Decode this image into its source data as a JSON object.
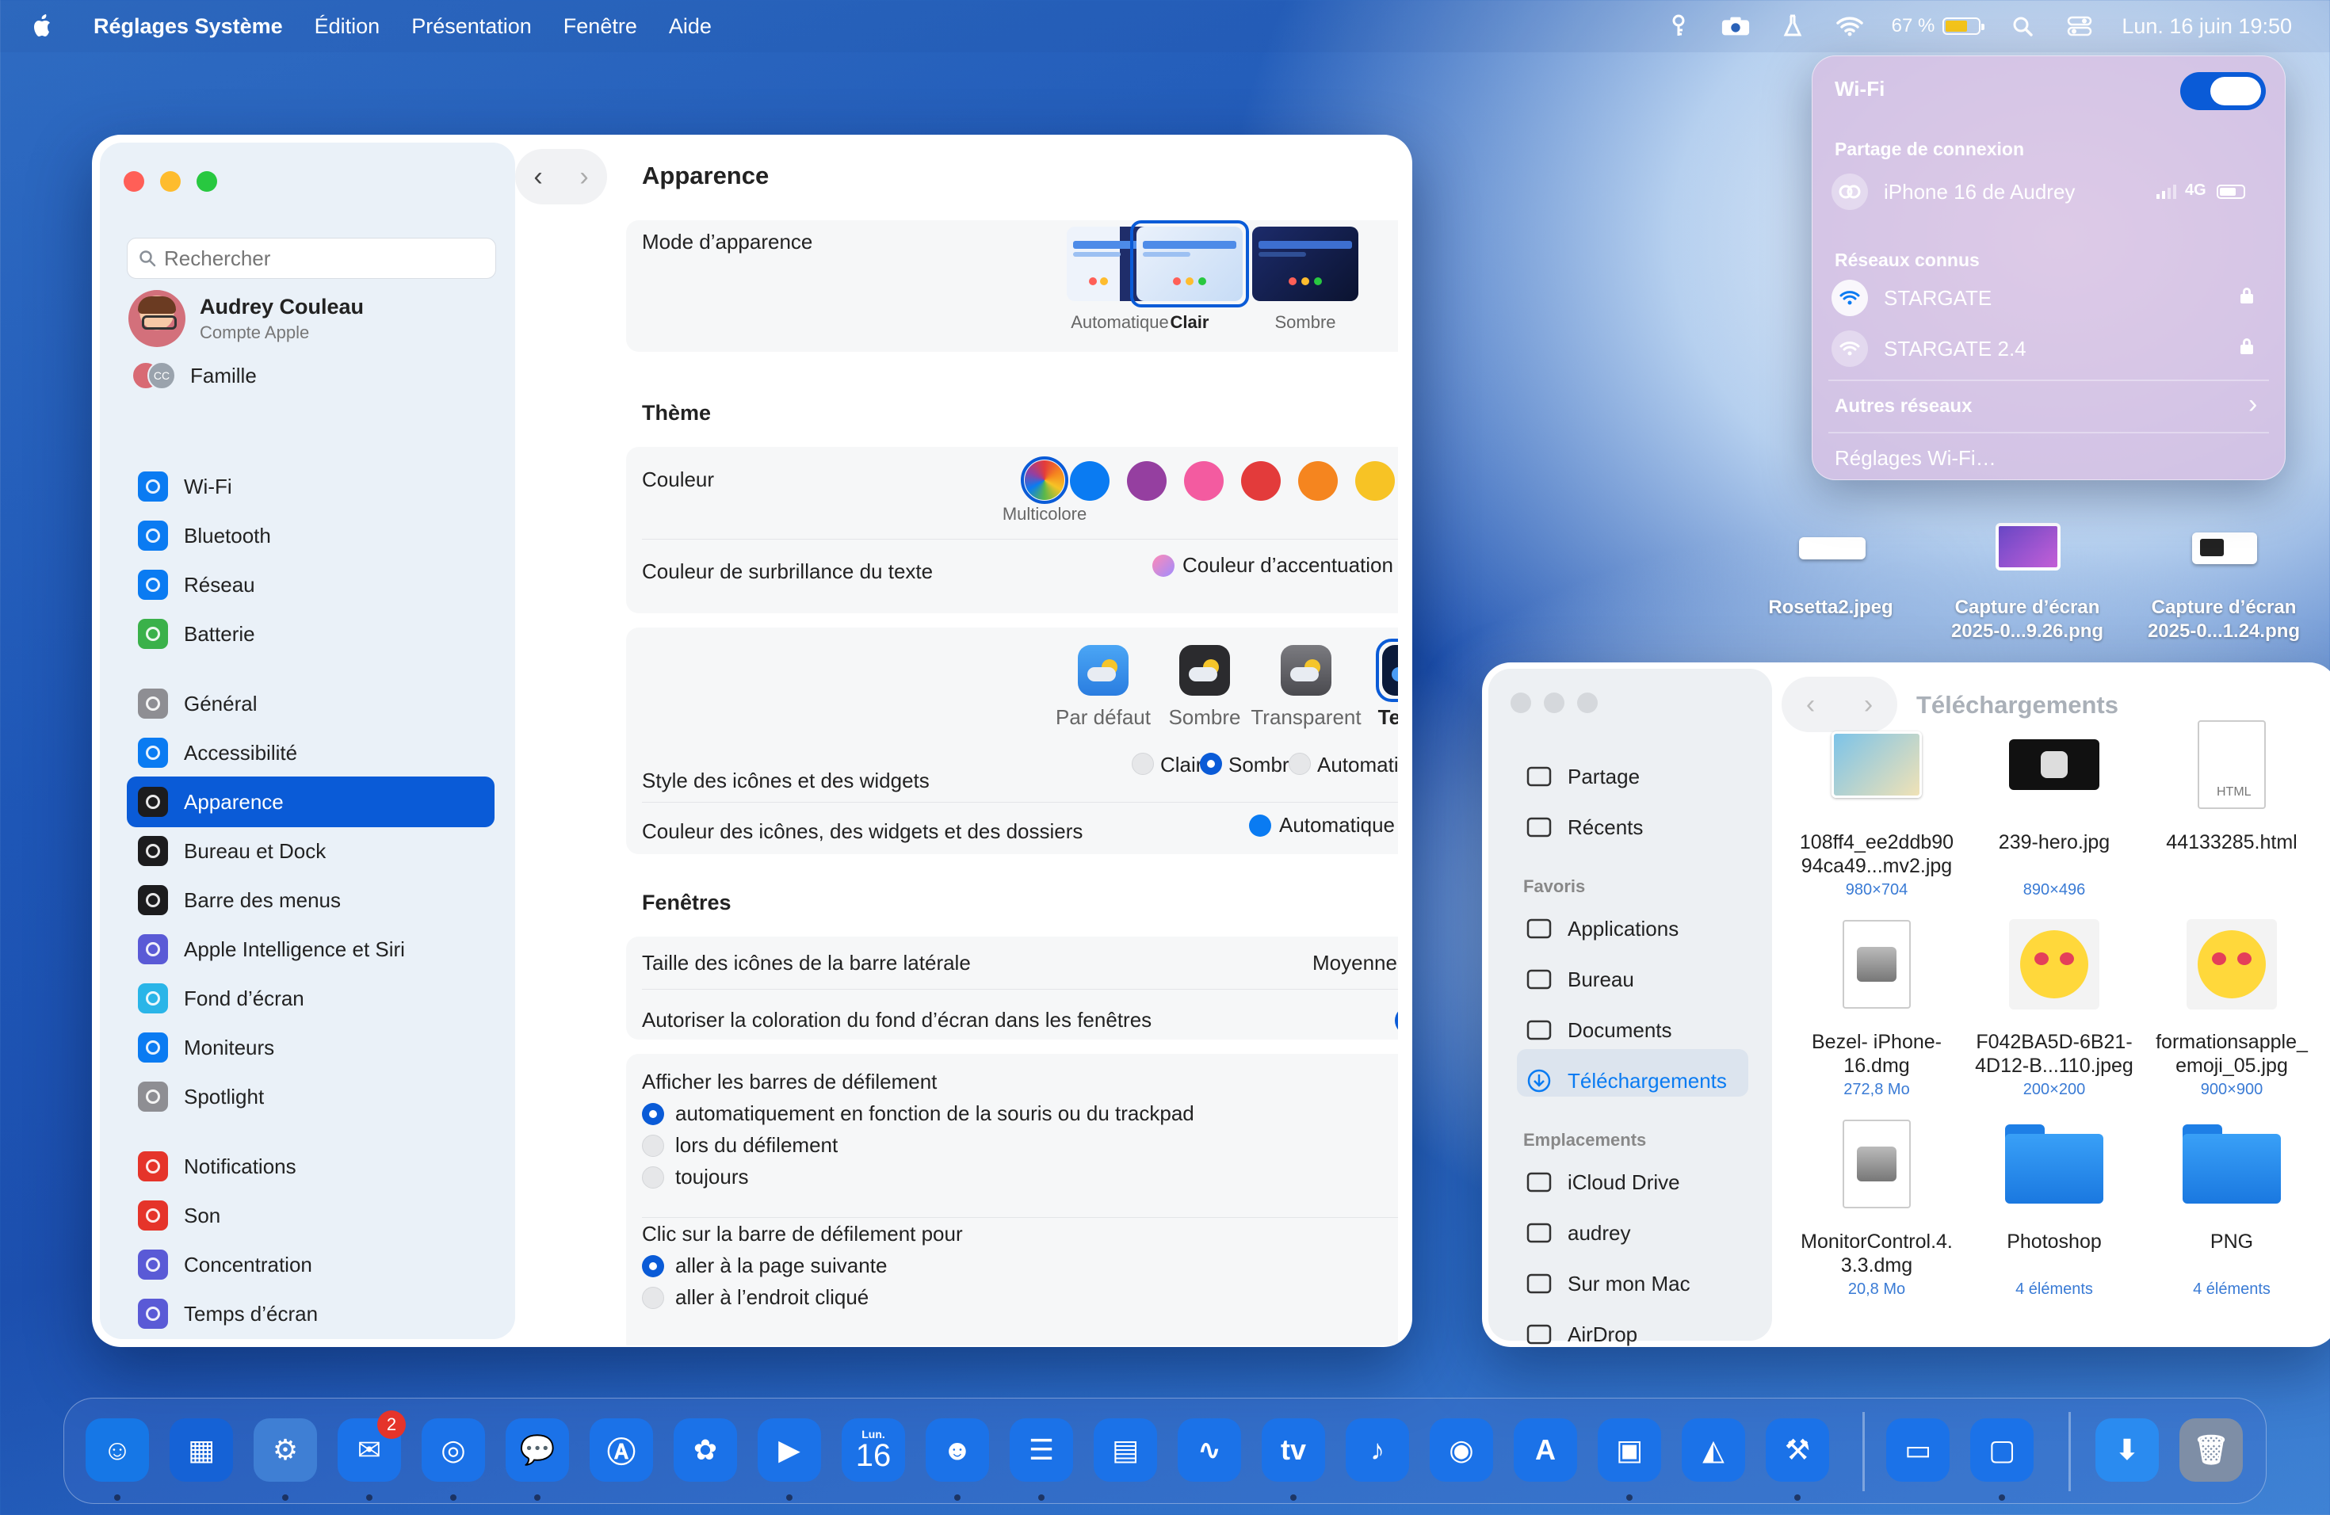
{
  "menubar": {
    "app": "Réglages Système",
    "menus": [
      "Édition",
      "Présentation",
      "Fenêtre",
      "Aide"
    ],
    "battery_pct": "67 %",
    "battery_level": 0.67,
    "datetime": "Lun. 16 juin 19:50"
  },
  "settings": {
    "search_placeholder": "Rechercher",
    "user": {
      "name": "Audrey Couleau",
      "sub": "Compte Apple"
    },
    "family": {
      "label": "Famille",
      "initials": "CC"
    },
    "sidebar": [
      {
        "label": "Wi-Fi",
        "icon": "wifi-icon",
        "color": "#0a7bf2"
      },
      {
        "label": "Bluetooth",
        "icon": "bluetooth-icon",
        "color": "#0a7bf2"
      },
      {
        "label": "Réseau",
        "icon": "globe-icon",
        "color": "#0a7bf2"
      },
      {
        "label": "Batterie",
        "icon": "battery-icon",
        "color": "#3ab14a"
      },
      {
        "label": "Général",
        "icon": "gear-icon",
        "color": "#8e8e93"
      },
      {
        "label": "Accessibilité",
        "icon": "accessibility-icon",
        "color": "#0a7bf2"
      },
      {
        "label": "Apparence",
        "icon": "appearance-icon",
        "color": "#1c1c1e"
      },
      {
        "label": "Bureau et Dock",
        "icon": "dock-icon",
        "color": "#1c1c1e"
      },
      {
        "label": "Barre des menus",
        "icon": "menubar-icon",
        "color": "#1c1c1e"
      },
      {
        "label": "Apple Intelligence et Siri",
        "icon": "siri-icon",
        "color": "#5a5ad6"
      },
      {
        "label": "Fond d’écran",
        "icon": "wallpaper-icon",
        "color": "#2ab5e8"
      },
      {
        "label": "Moniteurs",
        "icon": "display-icon",
        "color": "#0a7bf2"
      },
      {
        "label": "Spotlight",
        "icon": "spotlight-icon",
        "color": "#8e8e93"
      },
      {
        "label": "Notifications",
        "icon": "bell-icon",
        "color": "#e5342a"
      },
      {
        "label": "Son",
        "icon": "speaker-icon",
        "color": "#e5342a"
      },
      {
        "label": "Concentration",
        "icon": "moon-icon",
        "color": "#5a5ad6"
      },
      {
        "label": "Temps d’écran",
        "icon": "hourglass-icon",
        "color": "#5a5ad6"
      }
    ],
    "active": "Apparence",
    "title": "Apparence",
    "mode": {
      "label": "Mode d’apparence",
      "options": [
        "Automatique",
        "Clair",
        "Sombre"
      ],
      "selected": "Clair"
    },
    "theme": {
      "section": "Thème",
      "color_label": "Couleur",
      "color_selected": "Multicolore",
      "colors": [
        "#0a7bf2",
        "#953fa0",
        "#f35ba0",
        "#e33b3b",
        "#f5851f",
        "#f7c325",
        "#5ab84a",
        "#8e8e93"
      ],
      "highlight_label": "Couleur de surbrillance du texte",
      "highlight_value": "Couleur d’accentuation",
      "icon_style_label": "Style des icônes et des widgets",
      "icon_styles": [
        "Par défaut",
        "Sombre",
        "Transparent",
        "Teinté"
      ],
      "icon_style_selected": "Teinté",
      "tint_modes": [
        "Clair",
        "Sombre",
        "Automatique"
      ],
      "tint_selected": "Sombre",
      "icon_color_label": "Couleur des icônes, des widgets et des dossiers",
      "icon_color_value": "Automatique"
    },
    "windows": {
      "section": "Fenêtres",
      "sidebar_size_label": "Taille des icônes de la barre latérale",
      "sidebar_size_value": "Moyenne",
      "tinting_label": "Autoriser la coloration du fond d’écran dans les fenêtres",
      "tinting_on": true,
      "scrollbars_label": "Afficher les barres de défilement",
      "scrollbars_options": [
        "automatiquement en fonction de la souris ou du trackpad",
        "lors du défilement",
        "toujours"
      ],
      "scrollbars_selected": 0,
      "click_label": "Clic sur la barre de défilement pour",
      "click_options": [
        "aller à la page suivante",
        "aller à l’endroit cliqué"
      ],
      "click_selected": 0
    }
  },
  "wifi": {
    "title": "Wi-Fi",
    "on": true,
    "hotspot_header": "Partage de connexion",
    "hotspot": "iPhone 16 de Audrey",
    "hotspot_net": "4G",
    "known_header": "Réseaux connus",
    "known": [
      "STARGATE",
      "STARGATE 2.4"
    ],
    "other": "Autres réseaux",
    "settings": "Réglages Wi-Fi…"
  },
  "desktop": {
    "files": [
      {
        "name": "Rosetta2.jpeg"
      },
      {
        "name": "Capture d’écran 2025-0...9.26.png"
      },
      {
        "name": "Capture d’écran 2025-0...1.24.png"
      }
    ]
  },
  "finder": {
    "title": "Téléchargements",
    "top": [
      {
        "label": "Partage",
        "icon": "share-icon"
      },
      {
        "label": "Récents",
        "icon": "clock-icon"
      }
    ],
    "favorites_header": "Favoris",
    "favorites": [
      {
        "label": "Applications",
        "icon": "apps-icon"
      },
      {
        "label": "Bureau",
        "icon": "desktop-icon"
      },
      {
        "label": "Documents",
        "icon": "document-icon"
      },
      {
        "label": "Téléchargements",
        "icon": "download-icon"
      }
    ],
    "places_header": "Emplacements",
    "places": [
      {
        "label": "iCloud Drive",
        "icon": "cloud-icon"
      },
      {
        "label": "audrey",
        "icon": "home-icon"
      },
      {
        "label": "Sur mon Mac",
        "icon": "folder-icon"
      },
      {
        "label": "AirDrop",
        "icon": "airdrop-icon"
      }
    ],
    "files": [
      {
        "name": "108ff4_ee2ddb90 94ca49...mv2.jpg",
        "meta": "980×704"
      },
      {
        "name": "239-hero.jpg",
        "meta": "890×496"
      },
      {
        "name": "44133285.html",
        "meta": ""
      },
      {
        "name": "Bezel- iPhone-16.dmg",
        "meta": "272,8 Mo"
      },
      {
        "name": "F042BA5D-6B21- 4D12-B...110.jpeg",
        "meta": "200×200"
      },
      {
        "name": "formationsapple_ emoji_05.jpg",
        "meta": "900×900"
      },
      {
        "name": "MonitorControl.4. 3.3.dmg",
        "meta": "20,8 Mo"
      },
      {
        "name": "Photoshop",
        "meta": "4 éléments"
      },
      {
        "name": "PNG",
        "meta": "4 éléments"
      }
    ],
    "html_tag": "HTML"
  },
  "dock": {
    "mail_badge": "2",
    "calendar_day": "16",
    "calendar_month": "Lun."
  }
}
